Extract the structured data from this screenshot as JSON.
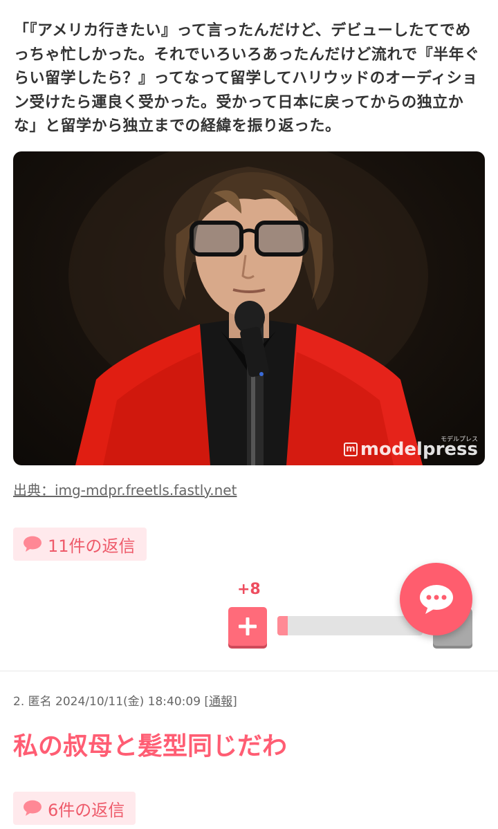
{
  "article": {
    "body_text": "「『アメリカ行きたい』って言ったんだけど、デビューしたてでめっちゃ忙しかった。それでいろいろあったんだけど流れで『半年ぐらい留学したら？』ってなって留学してハリウッドのオーディション受けたら運良く受かった。受かって日本に戻ってからの独立かな」と留学から独立までの経緯を振り返った。",
    "image": {
      "watermark": "modelpress",
      "watermark_sub": "モデルプレス"
    },
    "source_prefix": "出典：",
    "source_link": "img-mdpr.freetls.fastly.net"
  },
  "comment1": {
    "replies_label": "11件の返信",
    "vote_count": "+8",
    "vote_ratio": 0.07
  },
  "comment2": {
    "meta_text": "2. 匿名 2024/10/11(金) 18:40:09 [",
    "report_label": "通報",
    "meta_close": "]",
    "text": "私の叔母と髪型同じだわ",
    "replies_label": "6件の返信"
  },
  "colors": {
    "accent": "#ff5d6e",
    "reply_chip_bg": "#ffe9ec",
    "plus_button": "#ff6b7a",
    "minus_button": "#a9a9a9"
  },
  "icons": {
    "reply": "speech-bubble-icon",
    "plus": "plus-icon",
    "fab": "chat-bubble-icon"
  }
}
